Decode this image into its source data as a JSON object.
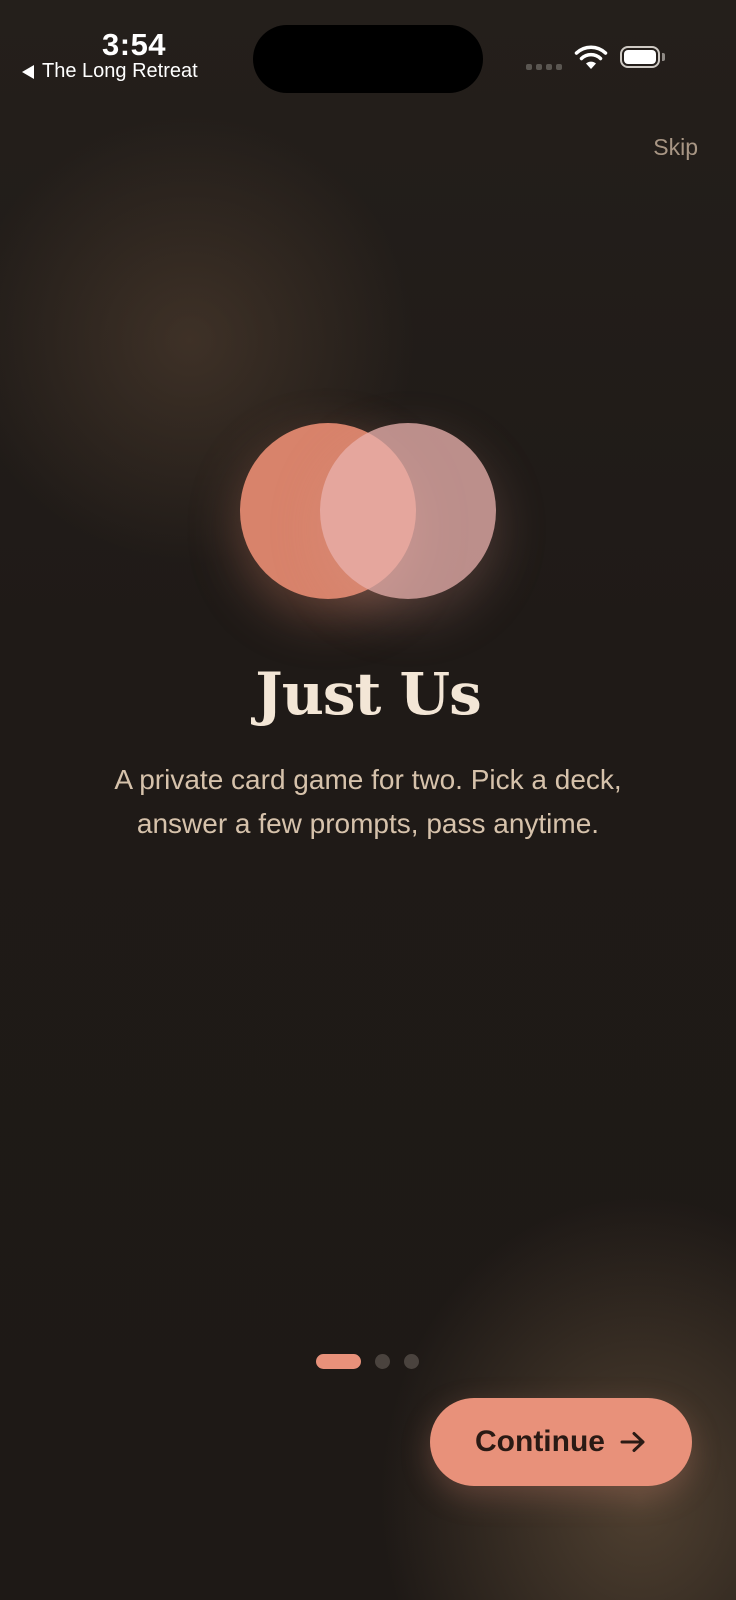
{
  "status_bar": {
    "time": "3:54",
    "back_app": "The Long Retreat",
    "icons": [
      "signal-icon",
      "wifi-icon",
      "battery-icon"
    ]
  },
  "header": {
    "skip_label": "Skip"
  },
  "hero": {
    "title": "Just Us",
    "subtitle": "A private card game for two. Pick a deck, answer a few prompts, pass anytime."
  },
  "pager": {
    "total_pages": 3,
    "current_page": 1
  },
  "actions": {
    "continue_label": "Continue",
    "continue_icon": "arrow-right-icon"
  },
  "colors": {
    "background": "#1f1a17",
    "accent": "#e8917a",
    "circle_left": "#d8836b",
    "circle_right": "#e8b0ac",
    "title": "#f3e6d6",
    "subtitle": "#d6c2ab",
    "skip": "#a89684"
  }
}
